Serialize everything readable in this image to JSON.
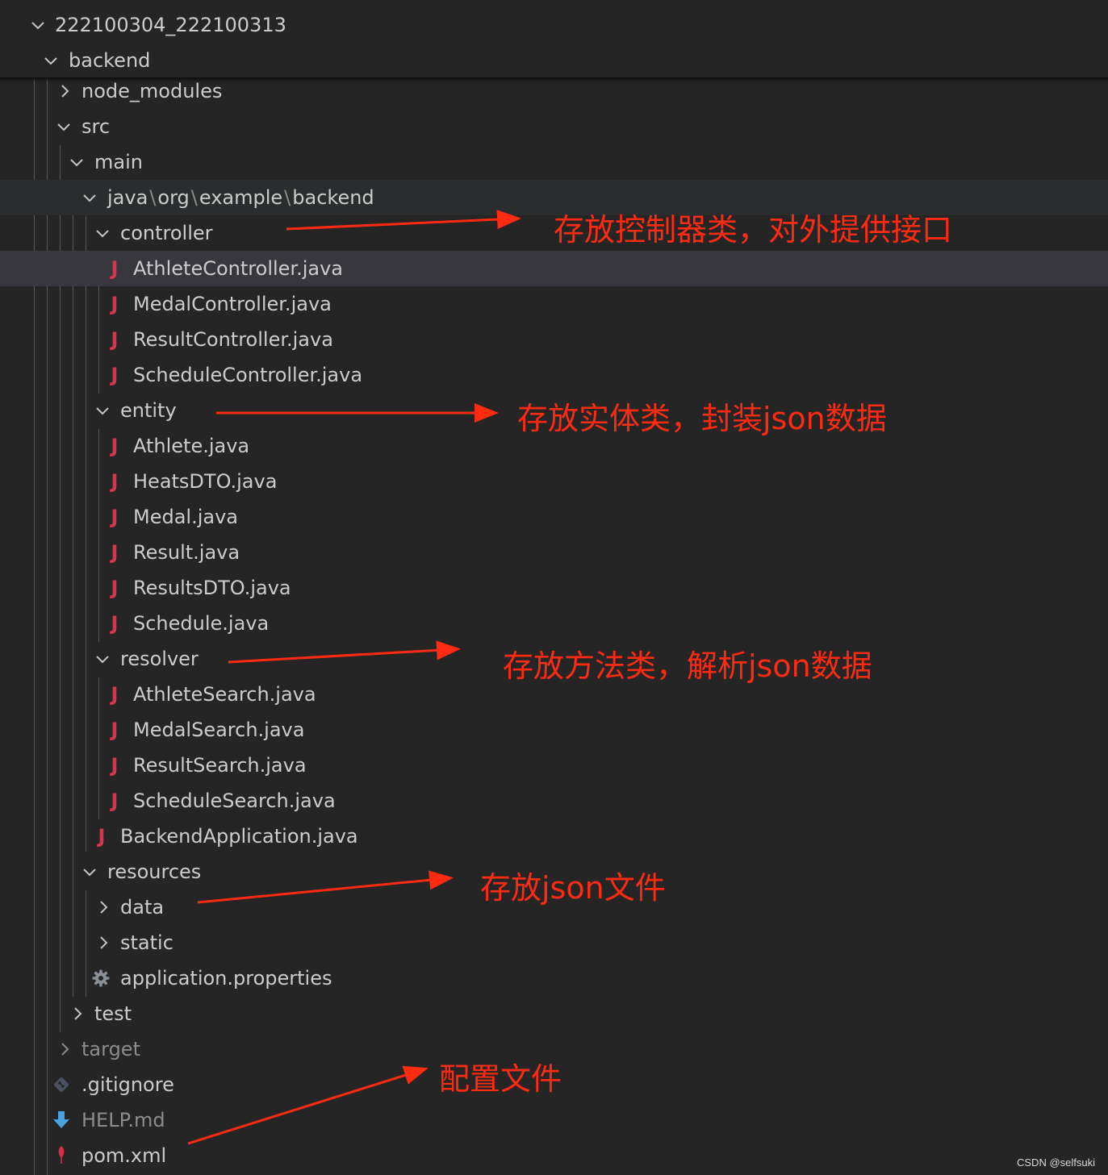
{
  "explorer": {
    "root": "222100304_222100313",
    "backend": "backend",
    "node_modules": "node_modules",
    "src": "src",
    "main": "main",
    "package_path": [
      "java",
      "org",
      "example",
      "backend"
    ],
    "controller": {
      "label": "controller",
      "files": [
        "AthleteController.java",
        "MedalController.java",
        "ResultController.java",
        "ScheduleController.java"
      ]
    },
    "entity": {
      "label": "entity",
      "files": [
        "Athlete.java",
        "HeatsDTO.java",
        "Medal.java",
        "Result.java",
        "ResultsDTO.java",
        "Schedule.java"
      ]
    },
    "resolver": {
      "label": "resolver",
      "files": [
        "AthleteSearch.java",
        "MedalSearch.java",
        "ResultSearch.java",
        "ScheduleSearch.java"
      ]
    },
    "backend_application": "BackendApplication.java",
    "resources": "resources",
    "data": "data",
    "static": "static",
    "application_properties": "application.properties",
    "test": "test",
    "target": "target",
    "gitignore": ".gitignore",
    "help": "HELP.md",
    "pom": "pom.xml",
    "java_icon_glyph": "J"
  },
  "annotations": {
    "controller_note": "存放控制器类，对外提供接口",
    "entity_note": "存放实体类，封装json数据",
    "resolver_note": "存放方法类，解析json数据",
    "resources_note": "存放json文件",
    "config_note": "配置文件"
  },
  "colors": {
    "background": "#252526",
    "selected_row": "#37373d",
    "text": "#cccccc",
    "dim_text": "#8c8c8c",
    "java_icon": "#d7344e",
    "annotation": "#ff2a12"
  },
  "watermark": "CSDN @selfsuki"
}
